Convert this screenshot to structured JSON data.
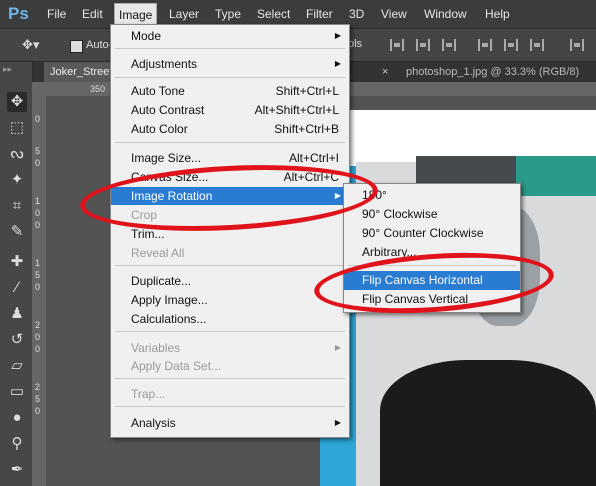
{
  "app": {
    "logo": "Ps"
  },
  "menubar": [
    "File",
    "Edit",
    "Image",
    "Layer",
    "Type",
    "Select",
    "Filter",
    "3D",
    "View",
    "Window",
    "Help"
  ],
  "options_bar": {
    "auto_label": "Auto-",
    "tools_suffix": "ols"
  },
  "tabs": [
    {
      "label": "Joker_Street"
    },
    {
      "label": "photoshop_1.jpg @ 33.3% (RGB/8)",
      "close": "×"
    }
  ],
  "ruler": {
    "horizontal": [
      "350"
    ],
    "vertical": [
      "0",
      "5",
      "0",
      "1",
      "0",
      "0",
      "1",
      "5",
      "0",
      "2",
      "0",
      "0",
      "2",
      "5",
      "0"
    ]
  },
  "image_menu": [
    {
      "label": "Mode",
      "arrow": "▶"
    },
    {
      "sep": true
    },
    {
      "label": "Adjustments",
      "arrow": "▶"
    },
    {
      "sep": true
    },
    {
      "label": "Auto Tone",
      "shortcut": "Shift+Ctrl+L"
    },
    {
      "label": "Auto Contrast",
      "shortcut": "Alt+Shift+Ctrl+L"
    },
    {
      "label": "Auto Color",
      "shortcut": "Shift+Ctrl+B"
    },
    {
      "sep": true
    },
    {
      "label": "Image Size...",
      "shortcut": "Alt+Ctrl+I"
    },
    {
      "label": "Canvas Size...",
      "shortcut": "Alt+Ctrl+C"
    },
    {
      "label": "Image Rotation",
      "arrow": "▶",
      "selected": true
    },
    {
      "label": "Crop",
      "disabled": true
    },
    {
      "label": "Trim..."
    },
    {
      "label": "Reveal All",
      "disabled": true
    },
    {
      "sep": true
    },
    {
      "label": "Duplicate..."
    },
    {
      "label": "Apply Image..."
    },
    {
      "label": "Calculations..."
    },
    {
      "sep": true
    },
    {
      "label": "Variables",
      "arrow": "▶",
      "disabled": true
    },
    {
      "label": "Apply Data Set...",
      "disabled": true
    },
    {
      "sep": true
    },
    {
      "label": "Trap...",
      "disabled": true
    },
    {
      "sep": true
    },
    {
      "label": "Analysis",
      "arrow": "▶"
    }
  ],
  "rotation_submenu": [
    {
      "label": "180°"
    },
    {
      "label": "90° Clockwise"
    },
    {
      "label": "90° Counter Clockwise"
    },
    {
      "label": "Arbitrary..."
    },
    {
      "sep": true
    },
    {
      "label": "Flip Canvas Horizontal",
      "selected": true
    },
    {
      "label": "Flip Canvas Vertical"
    }
  ],
  "tools": [
    "move-icon",
    "marquee-icon",
    "lasso-icon",
    "magic-wand-icon",
    "crop-icon",
    "eyedropper-icon",
    "healing-brush-icon",
    "brush-icon",
    "clone-stamp-icon",
    "history-brush-icon",
    "eraser-icon",
    "gradient-icon",
    "blur-icon",
    "dodge-icon",
    "pen-icon"
  ],
  "colors": {
    "selection": "#2a7bd2",
    "annotation": "#e0121a",
    "canvas_blue": "#2ea6d8"
  }
}
